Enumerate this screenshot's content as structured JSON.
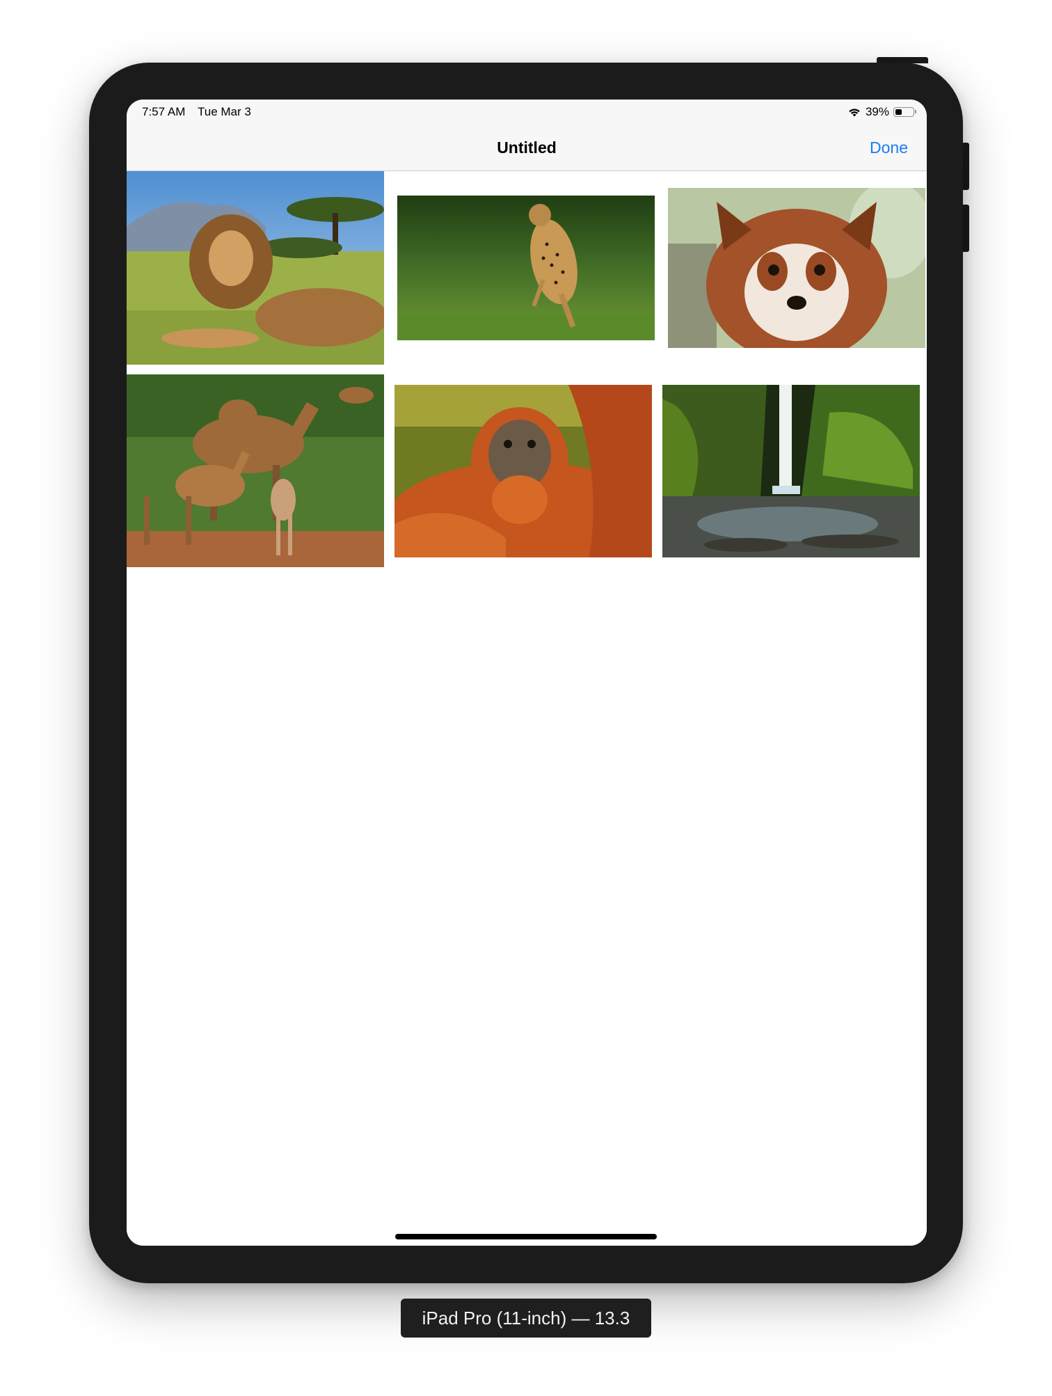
{
  "status_bar": {
    "time": "7:57 AM",
    "date": "Tue Mar 3",
    "battery_percent_text": "39%",
    "battery_level": 0.39,
    "wifi_icon": "wifi-icon",
    "battery_icon": "battery-icon"
  },
  "nav": {
    "title": "Untitled",
    "done_label": "Done",
    "done_color": "#1a7cf3"
  },
  "photos": [
    {
      "subject": "lion"
    },
    {
      "subject": "cheetah"
    },
    {
      "subject": "red panda"
    },
    {
      "subject": "camels"
    },
    {
      "subject": "orangutan"
    },
    {
      "subject": "waterfall"
    }
  ],
  "simulator_label": "iPad Pro (11-inch) — 13.3"
}
